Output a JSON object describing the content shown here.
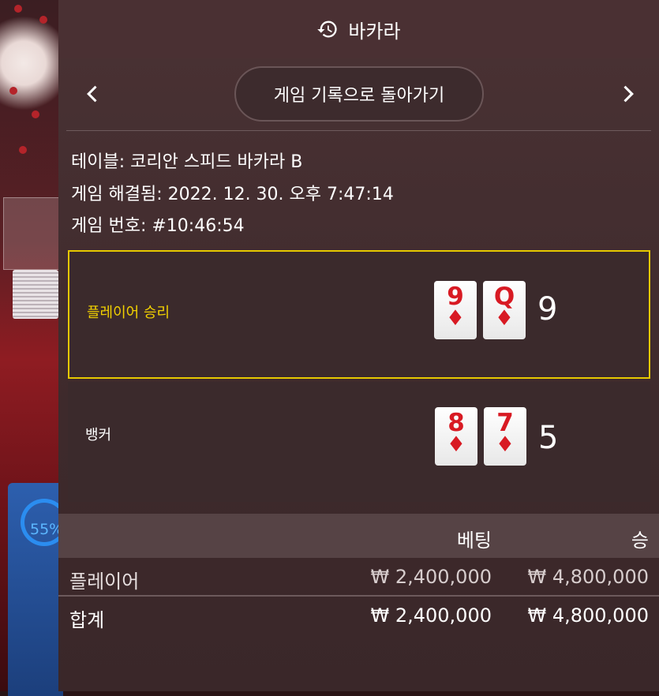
{
  "header": {
    "title": "바카라",
    "icon": "history-icon"
  },
  "nav": {
    "back_label": "게임 기록으로 돌아가기"
  },
  "info": {
    "table": "테이블: 코리안 스피드 바카라 B",
    "resolved": "게임 해결됨: 2022. 12. 30. 오후 7:47:14",
    "game_no": "게임 번호: #10:46:54"
  },
  "results": {
    "player": {
      "label": "플레이어 승리",
      "cards": [
        {
          "rank": "9",
          "suit": "♦"
        },
        {
          "rank": "Q",
          "suit": "♦"
        }
      ],
      "score": "9"
    },
    "banker": {
      "label": "뱅커",
      "cards": [
        {
          "rank": "8",
          "suit": "♦"
        },
        {
          "rank": "7",
          "suit": "♦"
        }
      ],
      "score": "5"
    }
  },
  "table": {
    "col_bet": "베팅",
    "col_win": "승",
    "rows": [
      {
        "label": "플레이어",
        "bet": "₩ 2,400,000",
        "win": "₩ 4,800,000"
      },
      {
        "label": "합계",
        "bet": "₩ 2,400,000",
        "win": "₩ 4,800,000"
      }
    ]
  },
  "background": {
    "progress_text": "55%"
  },
  "colors": {
    "win_border": "#e6c800",
    "win_label": "#f2d100",
    "card_red": "#d81a23"
  }
}
